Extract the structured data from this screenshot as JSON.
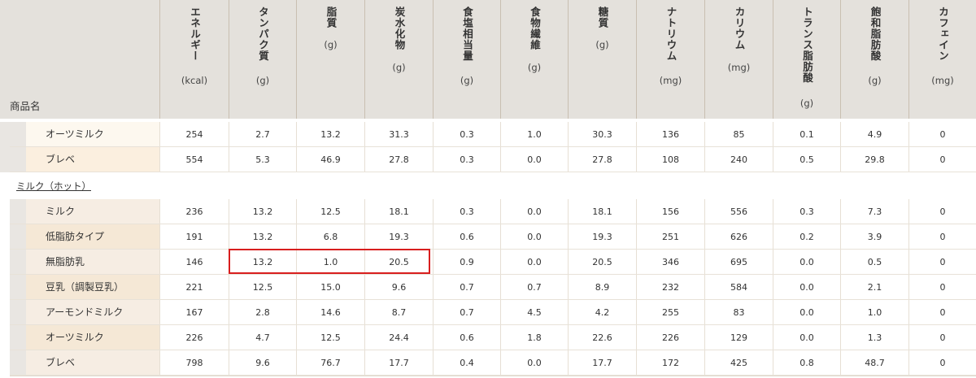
{
  "header": {
    "name_label": "商品名",
    "columns": [
      {
        "label": "エネルギー",
        "unit": "(kcal)"
      },
      {
        "label": "タンパク質",
        "unit": "(g)"
      },
      {
        "label": "脂質",
        "unit": "(g)"
      },
      {
        "label": "炭水化物",
        "unit": "(g)"
      },
      {
        "label": "食塩相当量",
        "unit": "(g)"
      },
      {
        "label": "食物繊維",
        "unit": "(g)"
      },
      {
        "label": "糖質",
        "unit": "(g)"
      },
      {
        "label": "ナトリウム",
        "unit": "(mg)"
      },
      {
        "label": "カリウム",
        "unit": "(mg)"
      },
      {
        "label": "トランス脂肪酸",
        "unit": "(g)"
      },
      {
        "label": "飽和脂肪酸",
        "unit": "(g)"
      },
      {
        "label": "カフェイン",
        "unit": "(mg)"
      }
    ]
  },
  "group1": {
    "rows": [
      {
        "name": "オーツミルク",
        "values": [
          "254",
          "2.7",
          "13.2",
          "31.3",
          "0.3",
          "1.0",
          "30.3",
          "136",
          "85",
          "0.1",
          "4.9",
          "0"
        ]
      },
      {
        "name": "ブレベ",
        "values": [
          "554",
          "5.3",
          "46.9",
          "27.8",
          "0.3",
          "0.0",
          "27.8",
          "108",
          "240",
          "0.5",
          "29.8",
          "0"
        ]
      }
    ]
  },
  "section": {
    "title": "ミルク（ホット）"
  },
  "group2": {
    "rows": [
      {
        "name": "ミルク",
        "values": [
          "236",
          "13.2",
          "12.5",
          "18.1",
          "0.3",
          "0.0",
          "18.1",
          "156",
          "556",
          "0.3",
          "7.3",
          "0"
        ]
      },
      {
        "name": "低脂肪タイプ",
        "values": [
          "191",
          "13.2",
          "6.8",
          "19.3",
          "0.6",
          "0.0",
          "19.3",
          "251",
          "626",
          "0.2",
          "3.9",
          "0"
        ]
      },
      {
        "name": "無脂肪乳",
        "values": [
          "146",
          "13.2",
          "1.0",
          "20.5",
          "0.9",
          "0.0",
          "20.5",
          "346",
          "695",
          "0.0",
          "0.5",
          "0"
        ]
      },
      {
        "name": "豆乳（調製豆乳）",
        "values": [
          "221",
          "12.5",
          "15.0",
          "9.6",
          "0.7",
          "0.7",
          "8.9",
          "232",
          "584",
          "0.0",
          "2.1",
          "0"
        ]
      },
      {
        "name": "アーモンドミルク",
        "values": [
          "167",
          "2.8",
          "14.6",
          "8.7",
          "0.7",
          "4.5",
          "4.2",
          "255",
          "83",
          "0.0",
          "1.0",
          "0"
        ]
      },
      {
        "name": "オーツミルク",
        "values": [
          "226",
          "4.7",
          "12.5",
          "24.4",
          "0.6",
          "1.8",
          "22.6",
          "226",
          "129",
          "0.0",
          "1.3",
          "0"
        ]
      },
      {
        "name": "ブレベ",
        "values": [
          "798",
          "9.6",
          "76.7",
          "17.7",
          "0.4",
          "0.0",
          "17.7",
          "172",
          "425",
          "0.8",
          "48.7",
          "0"
        ]
      }
    ]
  },
  "colors": {
    "header_bg": "#e4e1dc",
    "highlight": "#d81e1e",
    "row_name_bg": "#fbefdf"
  }
}
